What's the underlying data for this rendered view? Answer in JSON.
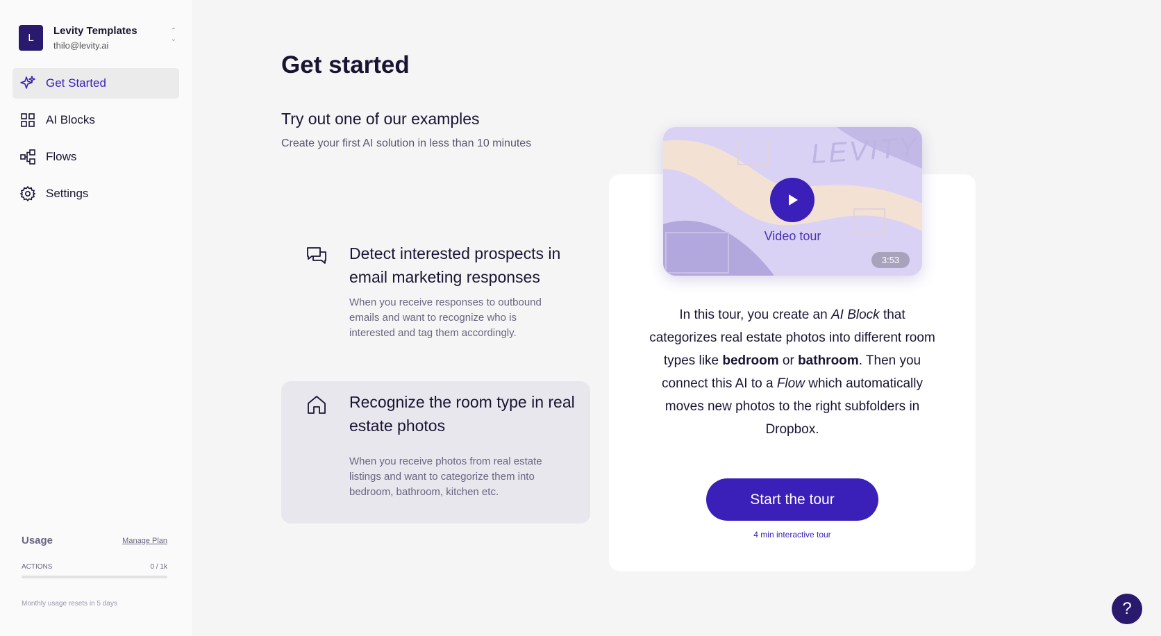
{
  "workspace": {
    "initial": "L",
    "name": "Levity Templates",
    "email": "thilo@levity.ai",
    "chevron_up": "⌃",
    "chevron_down": "⌄"
  },
  "nav": {
    "items": [
      {
        "label": "Get Started",
        "icon": "sparkle-icon",
        "active": true
      },
      {
        "label": "AI Blocks",
        "icon": "grid-icon",
        "active": false
      },
      {
        "label": "Flows",
        "icon": "flow-icon",
        "active": false
      },
      {
        "label": "Settings",
        "icon": "gear-icon",
        "active": false
      }
    ]
  },
  "usage": {
    "title": "Usage",
    "manage_label": "Manage Plan",
    "actions_label": "ACTIONS",
    "actions_value": "0 / 1k",
    "actions_fraction": 0,
    "reset_text": "Monthly usage resets in 5 days"
  },
  "main": {
    "title": "Get started",
    "subtitle": "Try out one of our examples",
    "subtitle_desc": "Create your first AI solution in less than 10 minutes",
    "examples": [
      {
        "icon": "chat-icon",
        "title": "Detect interested prospects in email marketing responses",
        "desc": "When you receive responses to outbound emails and want to recognize who is interested and tag them accordingly."
      },
      {
        "icon": "home-icon",
        "title": "Recognize the room type in real estate photos",
        "desc": "When you receive photos from real estate listings and want to categorize them into bedroom, bathroom, kitchen etc."
      }
    ]
  },
  "tour": {
    "watermark": "LEVITY",
    "video_label": "Video tour",
    "duration": "3:53",
    "text": {
      "t1": "In this tour, you create an ",
      "t2": "AI Block",
      "t3": " that categorizes real estate photos into different room types like ",
      "t4": "bedroom",
      "t5": " or ",
      "t6": "bathroom",
      "t7": ". Then you connect this AI to a ",
      "t8": "Flow",
      "t9": " which automatically moves new photos to the right subfolders in Dropbox."
    },
    "button_label": "Start the tour",
    "note": "4 min interactive tour"
  },
  "help": {
    "label": "?"
  },
  "colors": {
    "accent": "#3a1fb8",
    "dark": "#2a1a6e",
    "background": "#f5f5f5"
  }
}
